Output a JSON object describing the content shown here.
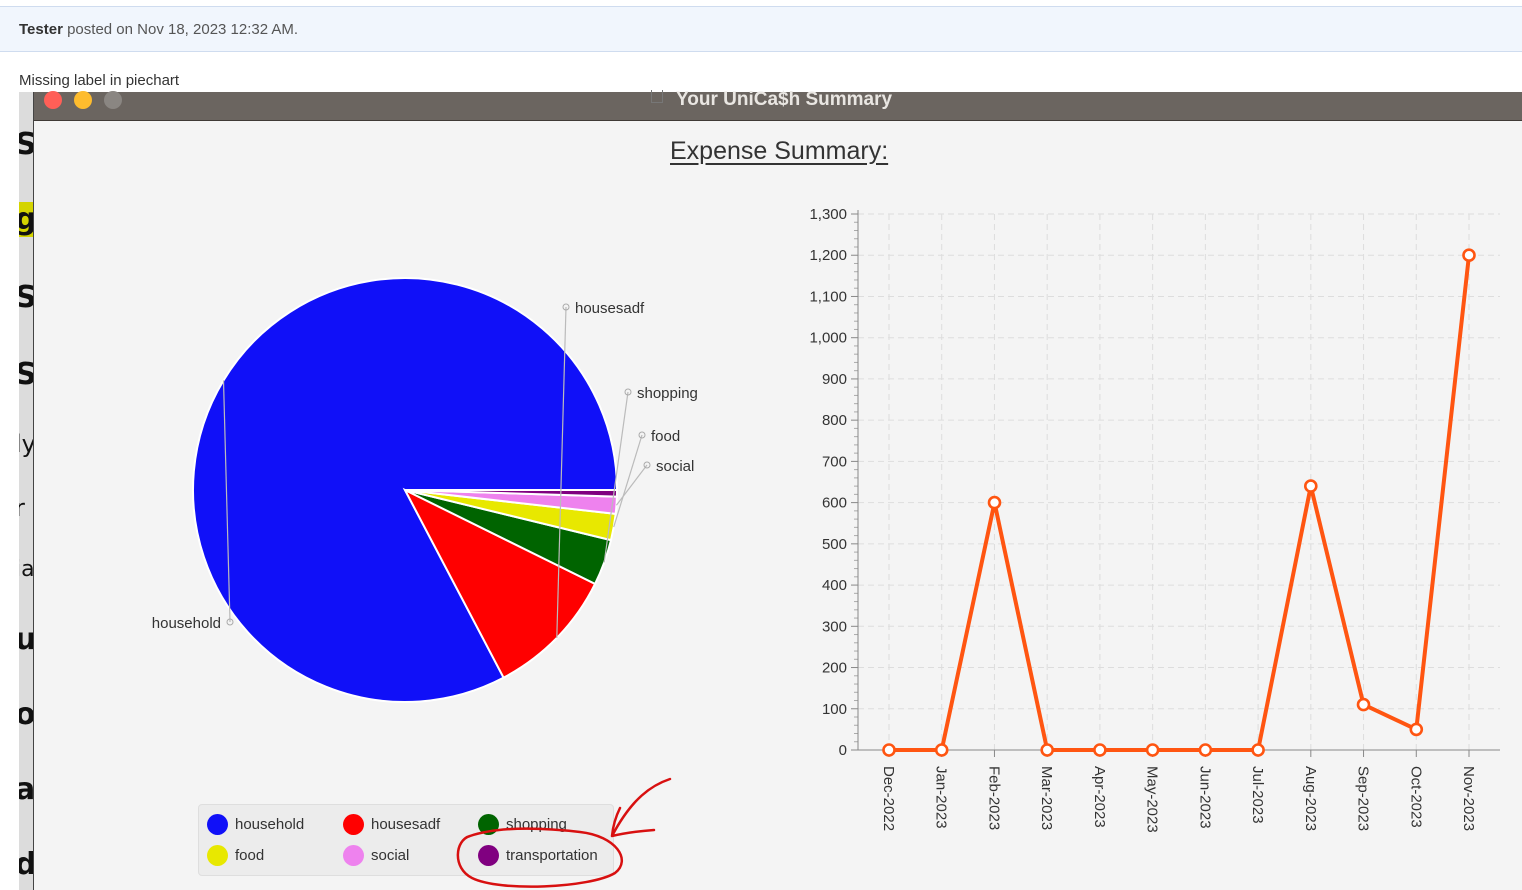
{
  "post": {
    "author": "Tester",
    "meta": "posted on Nov 18, 2023 12:32 AM.",
    "body": "Missing label in piechart"
  },
  "background_letters": [
    "S",
    "g",
    "S",
    "S",
    "ly",
    "r",
    "ia",
    "u",
    "o",
    "a",
    "d"
  ],
  "window": {
    "title": "Your UniCa$h Summary",
    "controls": [
      {
        "name": "close",
        "color": "#ff5f57"
      },
      {
        "name": "minimize",
        "color": "#febc2e"
      },
      {
        "name": "maximize",
        "color": "#8a8682"
      }
    ]
  },
  "summary_title": "Expense Summary:",
  "pie_chart": {
    "type": "pie",
    "slices": [
      {
        "label": "household",
        "value": 0.827,
        "color": "#1010f8"
      },
      {
        "label": "housesadf",
        "value": 0.1,
        "color": "#ff0000"
      },
      {
        "label": "shopping",
        "value": 0.035,
        "color": "#006400"
      },
      {
        "label": "food",
        "value": 0.02,
        "color": "#e8e800"
      },
      {
        "label": "social",
        "value": 0.013,
        "color": "#ee82ee"
      },
      {
        "label": "transportation",
        "value": 0.005,
        "color": "#800080"
      }
    ],
    "slice_labels_shown": [
      "housesadf",
      "shopping",
      "food",
      "social",
      "household"
    ],
    "legend": [
      {
        "label": "household",
        "color": "#1010f8"
      },
      {
        "label": "housesadf",
        "color": "#ff0000"
      },
      {
        "label": "shopping",
        "color": "#006400"
      },
      {
        "label": "food",
        "color": "#e8e800"
      },
      {
        "label": "social",
        "color": "#ee82ee"
      },
      {
        "label": "transportation",
        "color": "#800080"
      }
    ]
  },
  "chart_data": {
    "type": "line",
    "title": "",
    "xlabel": "",
    "ylabel": "",
    "categories": [
      "Dec-2022",
      "Jan-2023",
      "Feb-2023",
      "Mar-2023",
      "Apr-2023",
      "May-2023",
      "Jun-2023",
      "Jul-2023",
      "Aug-2023",
      "Sep-2023",
      "Oct-2023",
      "Nov-2023"
    ],
    "series": [
      {
        "values": [
          0,
          0,
          600,
          0,
          0,
          0,
          0,
          0,
          640,
          110,
          50,
          1200
        ],
        "color": "#ff5511"
      }
    ],
    "ylim": [
      0,
      1300
    ],
    "yticks": [
      0,
      100,
      200,
      300,
      400,
      500,
      600,
      700,
      800,
      900,
      1000,
      1100,
      1200,
      1300
    ],
    "ytick_labels": [
      "0",
      "100",
      "200",
      "300",
      "400",
      "500",
      "600",
      "700",
      "800",
      "900",
      "1,000",
      "1,100",
      "1,200",
      "1,300"
    ],
    "grid": true
  },
  "annotation": {
    "color": "#d81010"
  }
}
